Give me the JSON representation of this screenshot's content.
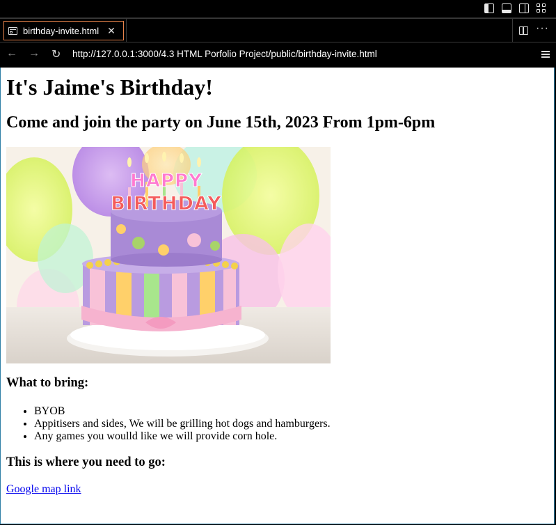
{
  "browser": {
    "tab_title": "birthday-invite.html",
    "url": "http://127.0.0.1:3000/4.3 HTML Porfolio Project/public/birthday-invite.html"
  },
  "page": {
    "heading": "It's Jaime's Birthday!",
    "subheading": "Come and join the party on June 15th, 2023 From 1pm-6pm",
    "image_alt": "Birthday cake",
    "cake_topper": "HAPPY BIRTHDAY",
    "bring_heading": "What to bring:",
    "bring_items": [
      "BYOB",
      "Appitisers and sides, We will be grilling hot dogs and hamburgers.",
      "Any games you woulld like we will provide corn hole."
    ],
    "location_heading": "This is where you need to go:",
    "map_link": "Google map link"
  },
  "colors": {
    "tab_border": "#e8834a",
    "link": "#0000ee",
    "frame": "#2d7fa6"
  }
}
